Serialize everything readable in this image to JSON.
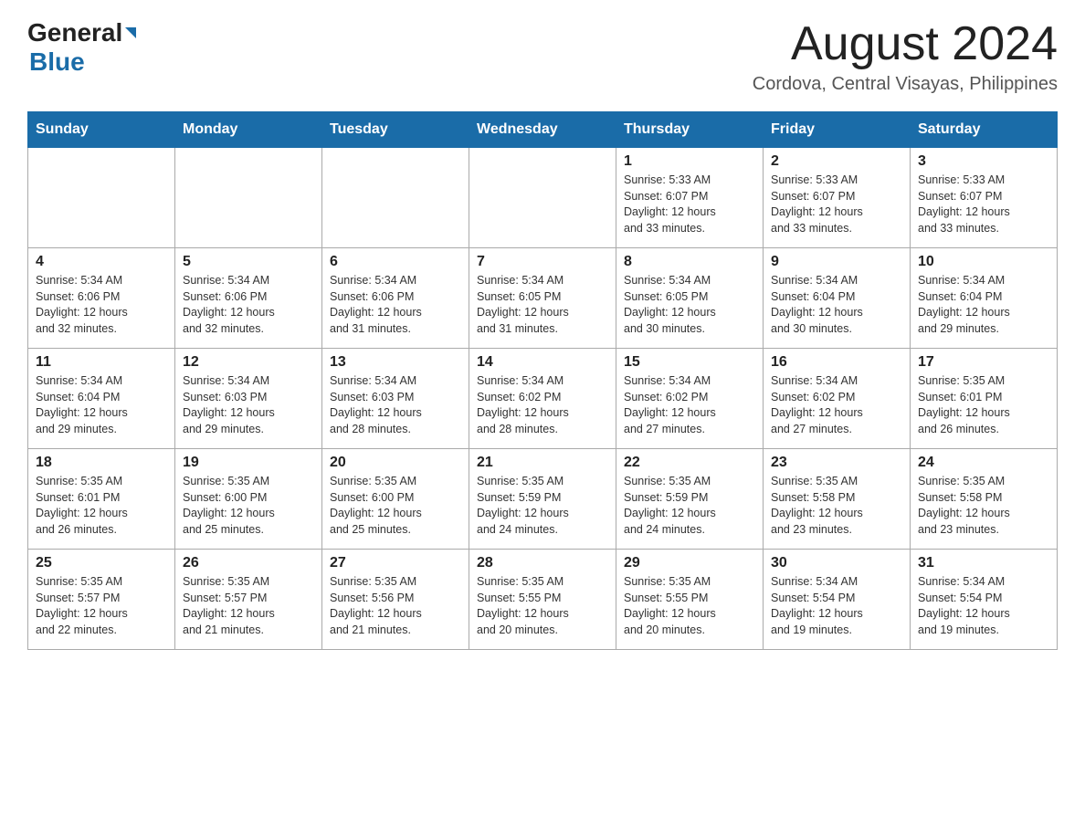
{
  "logo": {
    "general": "General",
    "blue": "Blue"
  },
  "title": {
    "month": "August 2024",
    "location": "Cordova, Central Visayas, Philippines"
  },
  "weekdays": [
    "Sunday",
    "Monday",
    "Tuesday",
    "Wednesday",
    "Thursday",
    "Friday",
    "Saturday"
  ],
  "weeks": [
    [
      {
        "day": "",
        "info": ""
      },
      {
        "day": "",
        "info": ""
      },
      {
        "day": "",
        "info": ""
      },
      {
        "day": "",
        "info": ""
      },
      {
        "day": "1",
        "info": "Sunrise: 5:33 AM\nSunset: 6:07 PM\nDaylight: 12 hours\nand 33 minutes."
      },
      {
        "day": "2",
        "info": "Sunrise: 5:33 AM\nSunset: 6:07 PM\nDaylight: 12 hours\nand 33 minutes."
      },
      {
        "day": "3",
        "info": "Sunrise: 5:33 AM\nSunset: 6:07 PM\nDaylight: 12 hours\nand 33 minutes."
      }
    ],
    [
      {
        "day": "4",
        "info": "Sunrise: 5:34 AM\nSunset: 6:06 PM\nDaylight: 12 hours\nand 32 minutes."
      },
      {
        "day": "5",
        "info": "Sunrise: 5:34 AM\nSunset: 6:06 PM\nDaylight: 12 hours\nand 32 minutes."
      },
      {
        "day": "6",
        "info": "Sunrise: 5:34 AM\nSunset: 6:06 PM\nDaylight: 12 hours\nand 31 minutes."
      },
      {
        "day": "7",
        "info": "Sunrise: 5:34 AM\nSunset: 6:05 PM\nDaylight: 12 hours\nand 31 minutes."
      },
      {
        "day": "8",
        "info": "Sunrise: 5:34 AM\nSunset: 6:05 PM\nDaylight: 12 hours\nand 30 minutes."
      },
      {
        "day": "9",
        "info": "Sunrise: 5:34 AM\nSunset: 6:04 PM\nDaylight: 12 hours\nand 30 minutes."
      },
      {
        "day": "10",
        "info": "Sunrise: 5:34 AM\nSunset: 6:04 PM\nDaylight: 12 hours\nand 29 minutes."
      }
    ],
    [
      {
        "day": "11",
        "info": "Sunrise: 5:34 AM\nSunset: 6:04 PM\nDaylight: 12 hours\nand 29 minutes."
      },
      {
        "day": "12",
        "info": "Sunrise: 5:34 AM\nSunset: 6:03 PM\nDaylight: 12 hours\nand 29 minutes."
      },
      {
        "day": "13",
        "info": "Sunrise: 5:34 AM\nSunset: 6:03 PM\nDaylight: 12 hours\nand 28 minutes."
      },
      {
        "day": "14",
        "info": "Sunrise: 5:34 AM\nSunset: 6:02 PM\nDaylight: 12 hours\nand 28 minutes."
      },
      {
        "day": "15",
        "info": "Sunrise: 5:34 AM\nSunset: 6:02 PM\nDaylight: 12 hours\nand 27 minutes."
      },
      {
        "day": "16",
        "info": "Sunrise: 5:34 AM\nSunset: 6:02 PM\nDaylight: 12 hours\nand 27 minutes."
      },
      {
        "day": "17",
        "info": "Sunrise: 5:35 AM\nSunset: 6:01 PM\nDaylight: 12 hours\nand 26 minutes."
      }
    ],
    [
      {
        "day": "18",
        "info": "Sunrise: 5:35 AM\nSunset: 6:01 PM\nDaylight: 12 hours\nand 26 minutes."
      },
      {
        "day": "19",
        "info": "Sunrise: 5:35 AM\nSunset: 6:00 PM\nDaylight: 12 hours\nand 25 minutes."
      },
      {
        "day": "20",
        "info": "Sunrise: 5:35 AM\nSunset: 6:00 PM\nDaylight: 12 hours\nand 25 minutes."
      },
      {
        "day": "21",
        "info": "Sunrise: 5:35 AM\nSunset: 5:59 PM\nDaylight: 12 hours\nand 24 minutes."
      },
      {
        "day": "22",
        "info": "Sunrise: 5:35 AM\nSunset: 5:59 PM\nDaylight: 12 hours\nand 24 minutes."
      },
      {
        "day": "23",
        "info": "Sunrise: 5:35 AM\nSunset: 5:58 PM\nDaylight: 12 hours\nand 23 minutes."
      },
      {
        "day": "24",
        "info": "Sunrise: 5:35 AM\nSunset: 5:58 PM\nDaylight: 12 hours\nand 23 minutes."
      }
    ],
    [
      {
        "day": "25",
        "info": "Sunrise: 5:35 AM\nSunset: 5:57 PM\nDaylight: 12 hours\nand 22 minutes."
      },
      {
        "day": "26",
        "info": "Sunrise: 5:35 AM\nSunset: 5:57 PM\nDaylight: 12 hours\nand 21 minutes."
      },
      {
        "day": "27",
        "info": "Sunrise: 5:35 AM\nSunset: 5:56 PM\nDaylight: 12 hours\nand 21 minutes."
      },
      {
        "day": "28",
        "info": "Sunrise: 5:35 AM\nSunset: 5:55 PM\nDaylight: 12 hours\nand 20 minutes."
      },
      {
        "day": "29",
        "info": "Sunrise: 5:35 AM\nSunset: 5:55 PM\nDaylight: 12 hours\nand 20 minutes."
      },
      {
        "day": "30",
        "info": "Sunrise: 5:34 AM\nSunset: 5:54 PM\nDaylight: 12 hours\nand 19 minutes."
      },
      {
        "day": "31",
        "info": "Sunrise: 5:34 AM\nSunset: 5:54 PM\nDaylight: 12 hours\nand 19 minutes."
      }
    ]
  ]
}
